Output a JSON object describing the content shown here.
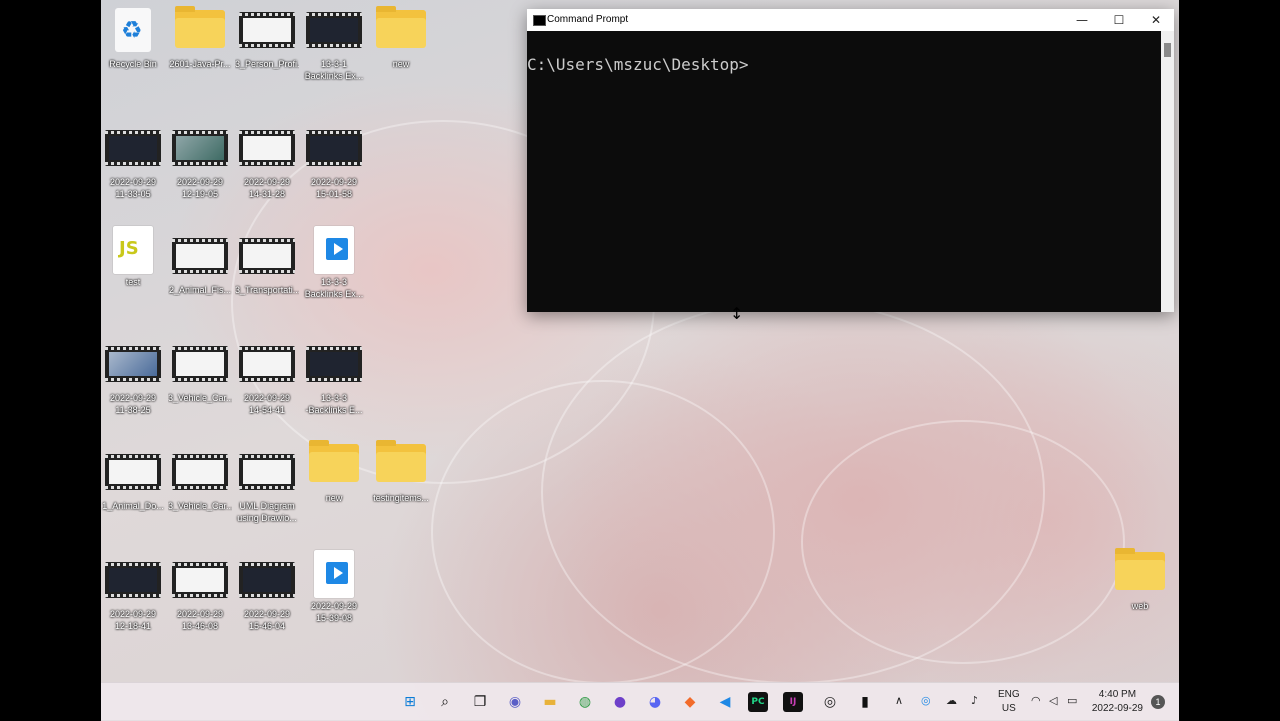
{
  "desktop_icons": [
    {
      "label": "Recycle Bin"
    },
    {
      "label": "2601-Java-Pr..."
    },
    {
      "label": "3_Person_Profi..."
    },
    {
      "label": "13-3-1\nBacklinks Ex..."
    },
    {
      "label": "new"
    },
    {
      "label": "2022-09-29\n11-33-05"
    },
    {
      "label": "2022-09-29\n12-19-05"
    },
    {
      "label": "2022-09-29\n14-31-28"
    },
    {
      "label": "2022-09-29\n15-01-58"
    },
    {
      "label": "test"
    },
    {
      "label": "2_Animal_Fis..."
    },
    {
      "label": "3_Transportati..."
    },
    {
      "label": "13-3-3\nBacklinks Ex..."
    },
    {
      "label": "2022-09-29\n11-38-25"
    },
    {
      "label": "3_Vehicle_Car..."
    },
    {
      "label": "2022-09-29\n14-54-41"
    },
    {
      "label": "13-3-3\n-Backlinks E..."
    },
    {
      "label": "1_Animal_Do..."
    },
    {
      "label": "3_Vehicle_Car..."
    },
    {
      "label": "UML Diagram\nusing Drawio..."
    },
    {
      "label": "new"
    },
    {
      "label": "testingitems..."
    },
    {
      "label": "2022-09-29\n12-18-41"
    },
    {
      "label": "2022-09-29\n13-46-08"
    },
    {
      "label": "2022-09-29\n15-46-04"
    },
    {
      "label": "2022-09-29\n15-39-08"
    },
    {
      "label": "web"
    }
  ],
  "cmd": {
    "title": "Command Prompt",
    "prompt": "C:\\Users\\mszuc\\Desktop>",
    "minimize": "—",
    "maximize": "☐",
    "close": "✕"
  },
  "cursor": {
    "glyph": "↕"
  },
  "taskbar": {
    "apps": [
      {
        "icon": "windows-start-icon",
        "glyph": "⊞",
        "color": "#0a7cd6"
      },
      {
        "icon": "search-icon",
        "glyph": "⌕",
        "color": "#111111"
      },
      {
        "icon": "task-view-icon",
        "glyph": "❐",
        "color": "#111111"
      },
      {
        "icon": "chat-icon",
        "glyph": "◉",
        "color": "#5b5fc7"
      },
      {
        "icon": "file-explorer-icon",
        "glyph": "▬",
        "color": "#e8b23a"
      },
      {
        "icon": "chrome-icon",
        "glyph": "◍",
        "color": "#2e9a44"
      },
      {
        "icon": "github-icon",
        "glyph": "●",
        "color": "#6e40c9"
      },
      {
        "icon": "discord-icon",
        "glyph": "◕",
        "color": "#5865f2"
      },
      {
        "icon": "brave-icon",
        "glyph": "◆",
        "color": "#f26b2a"
      },
      {
        "icon": "vscode-icon",
        "glyph": "◀",
        "color": "#1e88e5"
      },
      {
        "icon": "pycharm-icon",
        "glyph": "PC",
        "color": "#21d789"
      },
      {
        "icon": "intellij-icon",
        "glyph": "IJ",
        "color": "#c83fb7"
      },
      {
        "icon": "obs-icon",
        "glyph": "◎",
        "color": "#222222"
      },
      {
        "icon": "terminal-icon",
        "glyph": "▮",
        "color": "#111111"
      }
    ],
    "lang_line1": "ENG",
    "lang_line2": "US",
    "time": "4:40 PM",
    "date": "2022-09-29",
    "notification_count": "1"
  }
}
